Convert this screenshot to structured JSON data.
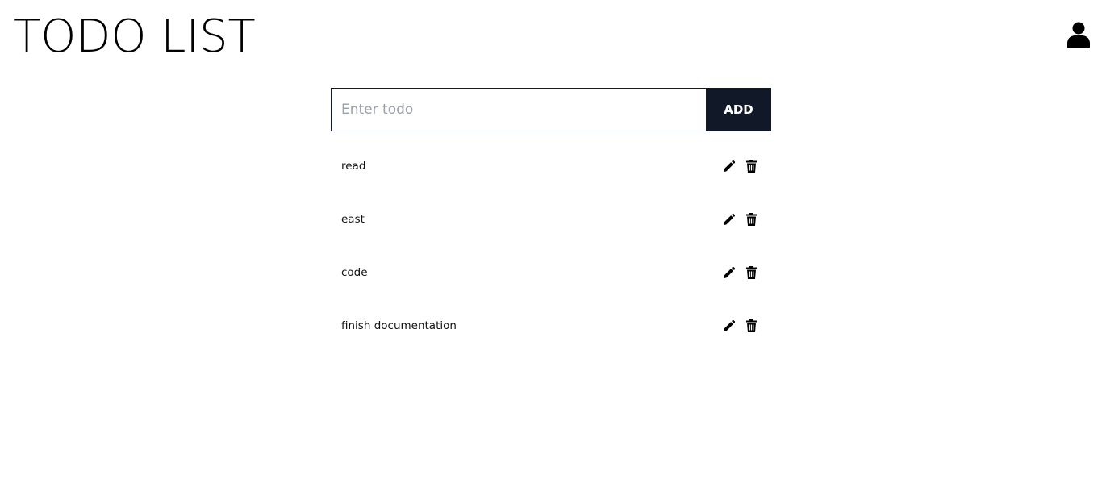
{
  "header": {
    "title": "TODO LIST",
    "user_icon": "user-icon"
  },
  "form": {
    "placeholder": "Enter todo",
    "value": "",
    "add_label": "ADD"
  },
  "todos": [
    {
      "text": "read",
      "edit_icon": "pencil-icon",
      "delete_icon": "trash-icon"
    },
    {
      "text": "east",
      "edit_icon": "pencil-icon",
      "delete_icon": "trash-icon"
    },
    {
      "text": "code",
      "edit_icon": "pencil-icon",
      "delete_icon": "trash-icon"
    },
    {
      "text": "finish documentation",
      "edit_icon": "pencil-icon",
      "delete_icon": "trash-icon"
    }
  ],
  "colors": {
    "accent": "#111827",
    "text": "#111111",
    "placeholder": "#9aa0a8",
    "background": "#ffffff"
  }
}
